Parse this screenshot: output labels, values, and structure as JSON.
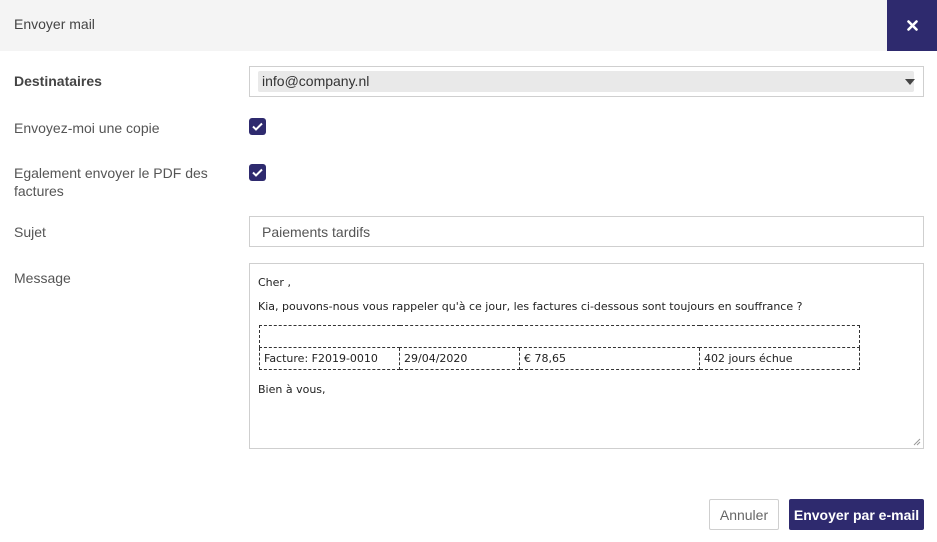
{
  "header": {
    "title": "Envoyer mail",
    "close_icon": "close-icon"
  },
  "form": {
    "recipients_label": "Destinataires",
    "recipients_value": "info@company.nl",
    "copy_label": "Envoyez-moi une copie",
    "copy_checked": true,
    "pdf_label_line1": "Egalement envoyer le PDF des",
    "pdf_label_line2": "factures",
    "pdf_checked": true,
    "subject_label": "Sujet",
    "subject_value": "Paiements tardifs",
    "message_label": "Message"
  },
  "message": {
    "greeting": "Cher ,",
    "intro": "Kia, pouvons-nous vous rappeler qu'à ce jour, les factures ci-dessous sont toujours en souffrance ?",
    "invoices": [
      {
        "invoice": "Facture: F2019-0010",
        "date": "29/04/2020",
        "amount": "€ 78,65",
        "overdue": "402 jours échue"
      }
    ],
    "closing": "Bien à vous,"
  },
  "actions": {
    "cancel_label": "Annuler",
    "send_label": "Envoyer par e-mail"
  },
  "colors": {
    "accent": "#2e2a6e",
    "header_bg": "#f4f4f4",
    "border": "#cfcfcf"
  }
}
